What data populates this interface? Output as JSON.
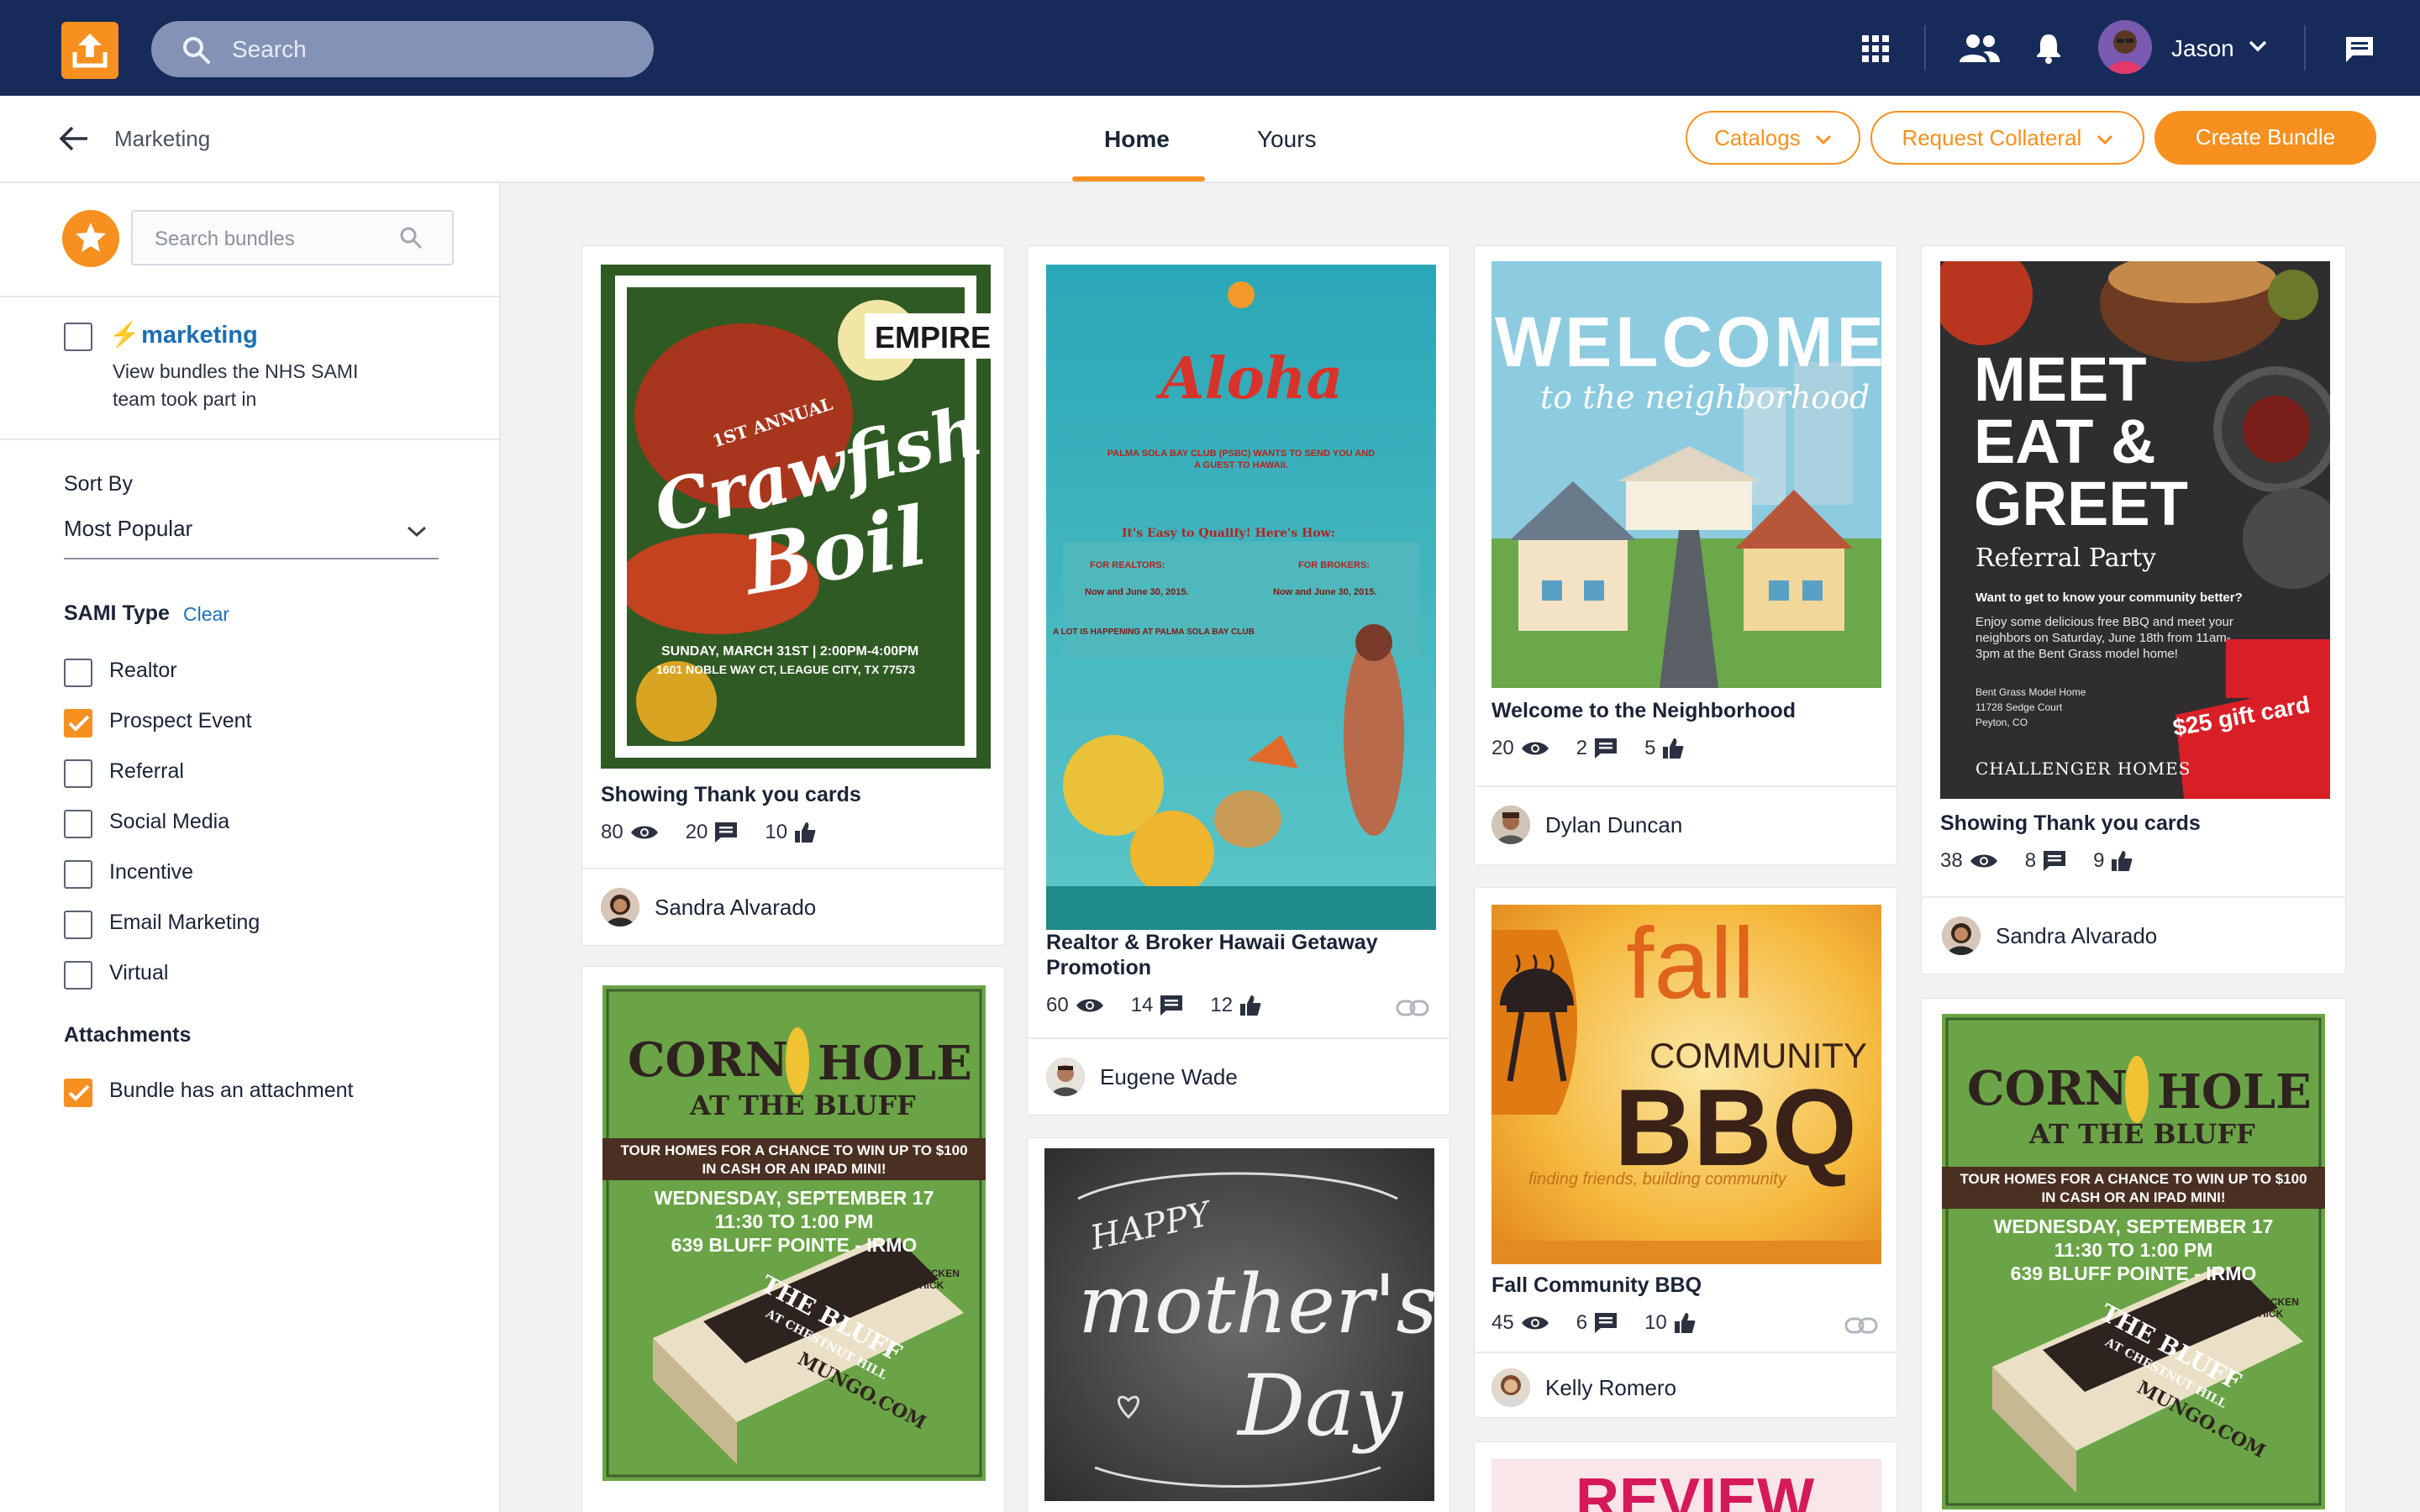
{
  "topbar": {
    "search_placeholder": "Search",
    "user_name": "Jason"
  },
  "subbar": {
    "back_label": "Marketing",
    "tabs": [
      {
        "label": "Home"
      },
      {
        "label": "Yours"
      }
    ],
    "catalogs_label": "Catalogs",
    "request_label": "Request Collateral",
    "create_label": "Create Bundle"
  },
  "sidebar": {
    "search_placeholder": "Search bundles",
    "marketing_title": "marketing",
    "marketing_desc": "View bundles the NHS SAMI team took part in",
    "sort_label": "Sort By",
    "sort_value": "Most Popular",
    "type_label": "SAMI Type",
    "clear_label": "Clear",
    "types": [
      {
        "label": "Realtor",
        "checked": false
      },
      {
        "label": "Prospect Event",
        "checked": true
      },
      {
        "label": "Referral",
        "checked": false
      },
      {
        "label": "Social Media",
        "checked": false
      },
      {
        "label": "Incentive",
        "checked": false
      },
      {
        "label": "Email Marketing",
        "checked": false
      },
      {
        "label": "Virtual",
        "checked": false
      }
    ],
    "attachments_label": "Attachments",
    "attachment_option": {
      "label": "Bundle has an attachment",
      "checked": true
    }
  },
  "cards": {
    "c1": {
      "title": "Showing Thank you cards",
      "views": "80",
      "comments": "20",
      "likes": "10",
      "author": "Sandra Alvarado",
      "poster": {
        "brand": "EMPIRE",
        "line1": "1ST ANNUAL",
        "line2": "Crawfish",
        "line3": "Boil",
        "date": "SUNDAY, MARCH 31ST | 2:00PM-4:00PM",
        "address": "1601 NOBLE WAY CT, LEAGUE CITY, TX 77573"
      }
    },
    "c2": {
      "title": "Realtor & Broker Hawaii Getaway Promotion",
      "views": "60",
      "comments": "14",
      "likes": "12",
      "author": "Eugene Wade",
      "poster": {
        "headline": "Aloha",
        "sub": "PALMA SOLA BAY CLUB (PSBC) WANTS TO SEND YOU AND A GUEST TO HAWAII.",
        "qualify": "It's Easy to Qualify! Here's How:",
        "realtors": "FOR REALTORS:",
        "brokers": "FOR BROKERS:",
        "when_r": "Now and June 30, 2015.",
        "when_b": "Now and June 30, 2015.",
        "happening": "A LOT IS HAPPENING AT PALMA SOLA BAY CLUB"
      }
    },
    "c3": {
      "title": "Welcome to the Neighborhood",
      "views": "20",
      "comments": "2",
      "likes": "5",
      "author": "Dylan Duncan",
      "poster": {
        "line1": "WELCOME",
        "line2": "to the neighborhood"
      }
    },
    "c4": {
      "title": "Showing Thank you cards",
      "views": "38",
      "comments": "8",
      "likes": "9",
      "author": "Sandra Alvarado",
      "poster": {
        "l1": "MEET",
        "l2": "EAT &",
        "l3": "GREET",
        "l4": "Referral Party",
        "q": "Want to get to know your community better?",
        "body": "Enjoy some delicious free BBQ and meet your neighbors on Saturday, June 18th from 11am-3pm at the Bent Grass model home!",
        "addr": "Bent Grass Model Home 11728 Sedge Court Peyton, CO",
        "gift": "$25 gift card",
        "brand": "CHALLENGER HOMES"
      }
    },
    "c5": {
      "poster": {
        "l1": "CORN",
        "l2": "HOLE",
        "l3": "AT THE BLUFF",
        "band": "TOUR HOMES FOR A CHANCE TO WIN UP TO $100 IN CASH OR AN IPAD MINI!",
        "date": "WEDNESDAY, SEPTEMBER 17",
        "time": "11:30 TO 1:00 PM",
        "addr": "639 BLUFF POINTE - IRMO",
        "lunch": "LUNCH BY CHICKEN SALAD CHICK",
        "board1": "THE BLUFF",
        "board2": "AT CHESTNUT HILL",
        "board3": "MUNGO.COM"
      }
    },
    "c6": {
      "poster": {
        "l1": "HAPPY",
        "l2": "mother's",
        "l3": "Day"
      }
    },
    "c7": {
      "title": "Fall Community BBQ",
      "views": "45",
      "comments": "6",
      "likes": "10",
      "author": "Kelly Romero",
      "poster": {
        "l1": "fall",
        "l2": "COMMUNITY",
        "l3": "BBQ",
        "l4": "finding friends, building community"
      }
    },
    "c8": {
      "poster": {
        "l1": "REVIEW"
      }
    },
    "c9": {
      "poster": {
        "l1": "CORN",
        "l2": "HOLE",
        "l3": "AT THE BLUFF",
        "band": "TOUR HOMES FOR A CHANCE TO WIN UP TO $100 IN CASH OR AN IPAD MINI!",
        "date": "WEDNESDAY, SEPTEMBER 17",
        "time": "11:30 TO 1:00 PM",
        "addr": "639 BLUFF POINTE - IRMO",
        "lunch": "LUNCH BY CHICKEN SALAD CHICK",
        "board1": "THE BLUFF",
        "board2": "AT CHESTNUT HILL",
        "board3": "MUNGO.COM"
      }
    }
  },
  "colors": {
    "navy": "#172b5b",
    "orange": "#f7901e",
    "link": "#1a6fb5"
  }
}
